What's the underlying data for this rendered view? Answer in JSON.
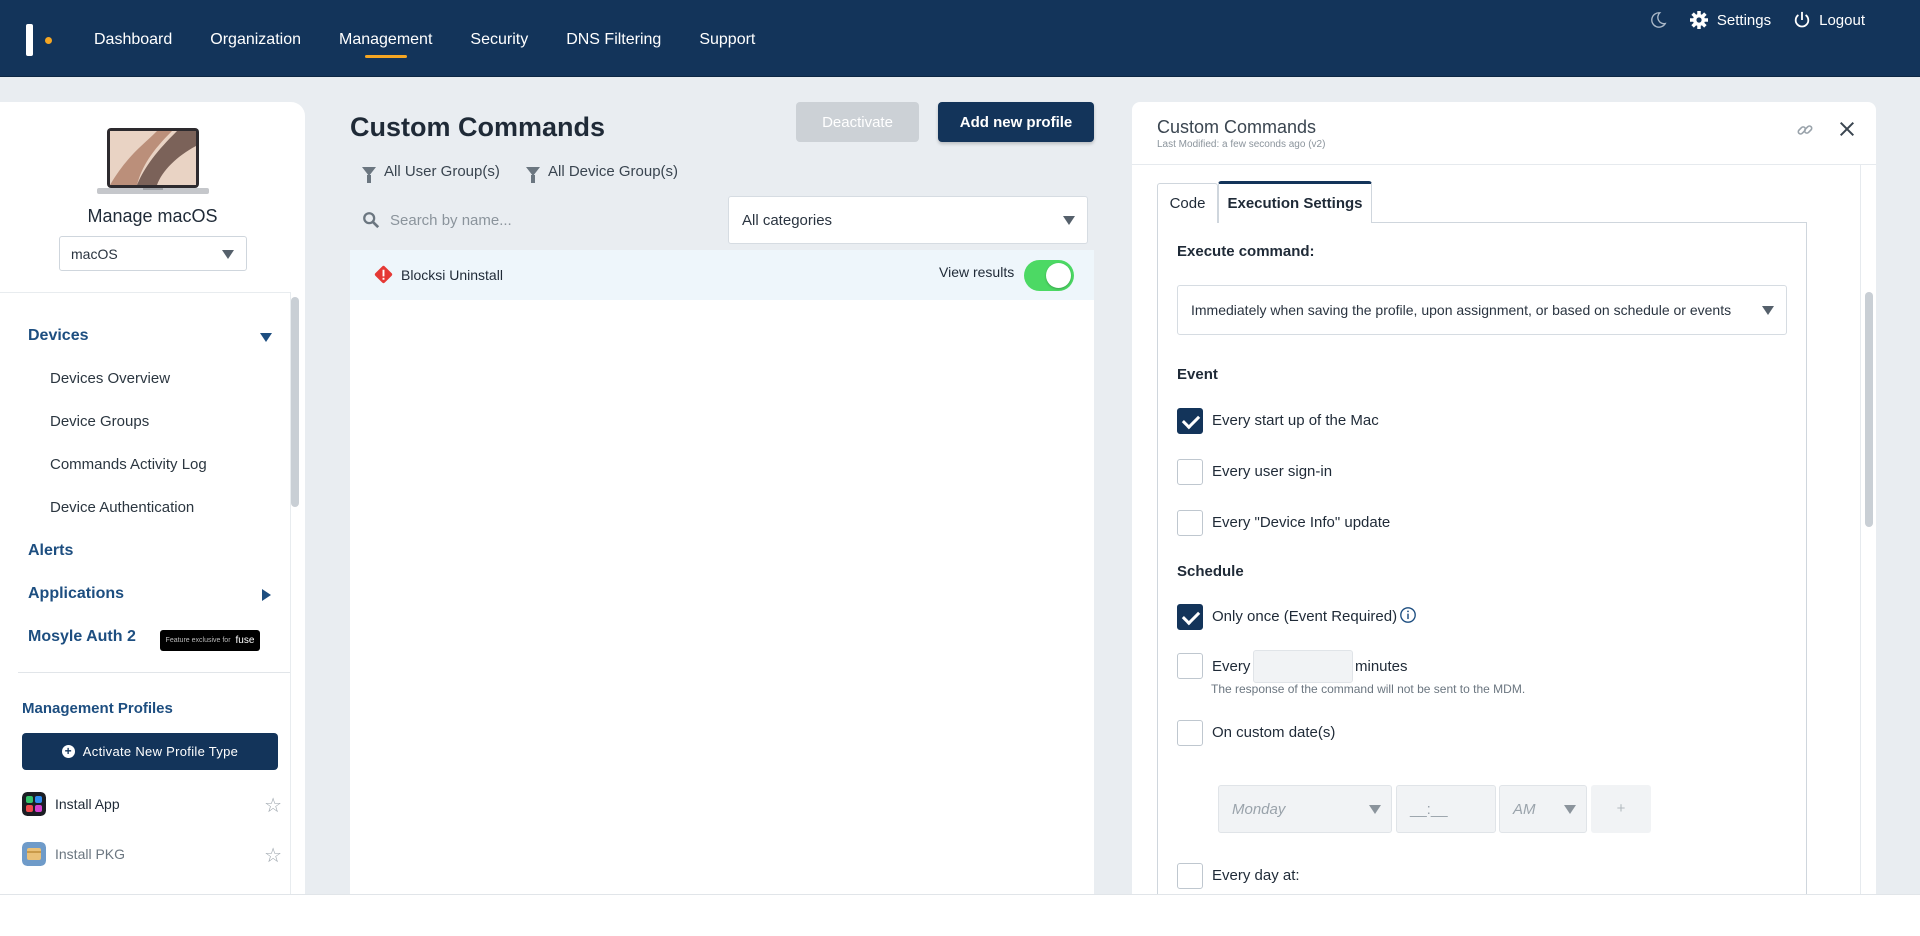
{
  "topbar": {
    "nav": [
      "Dashboard",
      "Organization",
      "Management",
      "Security",
      "DNS Filtering",
      "Support"
    ],
    "active": "Management",
    "settings_label": "Settings",
    "logout_label": "Logout",
    "accent_color": "#f5a623",
    "bg_color": "#13345a"
  },
  "sidebar": {
    "title": "Manage macOS",
    "os_select": "macOS",
    "sections": {
      "devices": "Devices",
      "devices_items": [
        "Devices Overview",
        "Device Groups",
        "Commands Activity Log",
        "Device Authentication"
      ],
      "alerts": "Alerts",
      "applications": "Applications",
      "mosyle_auth": "Mosyle Auth 2",
      "badge_prefix": "Feature exclusive for",
      "badge_brand": "fuse"
    },
    "management_profiles": "Management Profiles",
    "activate_button": "Activate New Profile Type",
    "profiles": [
      "Install App",
      "Install PKG"
    ]
  },
  "main": {
    "title": "Custom Commands",
    "deactivate_label": "Deactivate",
    "add_label": "Add new profile",
    "filter_user": "All User Group(s)",
    "filter_device": "All Device Group(s)",
    "search_placeholder": "Search by name...",
    "category": "All categories",
    "rows": [
      {
        "name": "Blocksi Uninstall",
        "action": "View results",
        "enabled": true
      }
    ]
  },
  "panel": {
    "title": "Custom Commands",
    "subtitle": "Last Modified: a few seconds ago (v2)",
    "tabs": [
      "Code",
      "Execution Settings"
    ],
    "active_tab": "Execution Settings",
    "execute_label": "Execute command:",
    "execute_value": "Immediately when saving the profile, upon assignment, or based on schedule or events",
    "event_label": "Event",
    "events": [
      {
        "label": "Every start up of the Mac",
        "checked": true
      },
      {
        "label": "Every user sign-in",
        "checked": false
      },
      {
        "label": "Every \"Device Info\" update",
        "checked": false
      }
    ],
    "schedule_label": "Schedule",
    "only_once": "Only once (Event Required)",
    "every_label": "Every",
    "minutes_label": "minutes",
    "every_note": "The response of the command will not be sent to the MDM.",
    "custom_dates": "On custom date(s)",
    "day_placeholder": "Monday",
    "time_placeholder": "__:__",
    "ampm_placeholder": "AM",
    "add_plus": "+",
    "every_day": "Every day at:"
  }
}
